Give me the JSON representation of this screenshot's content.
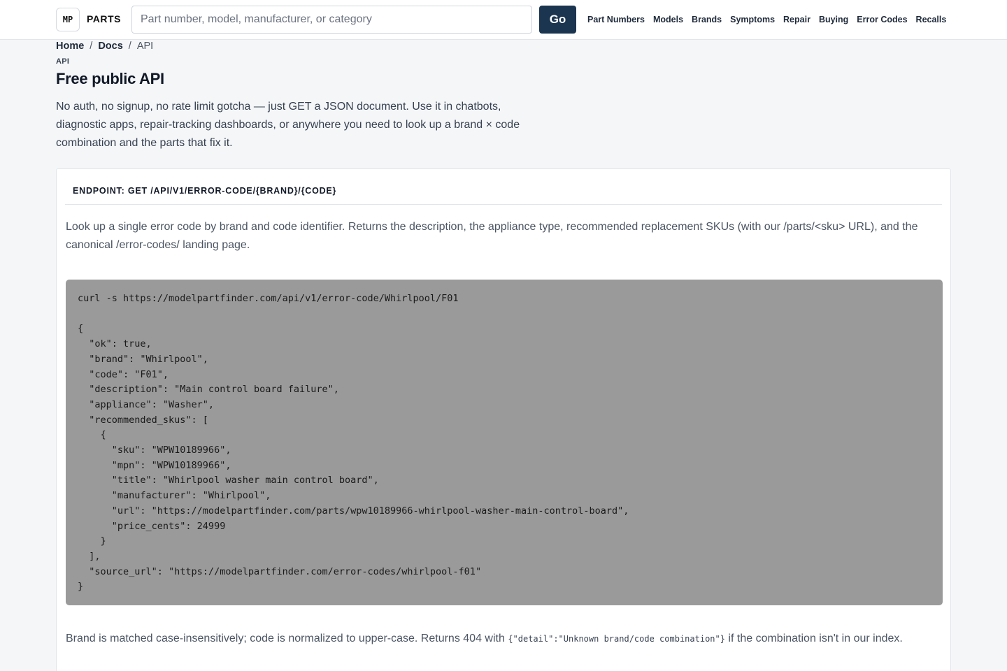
{
  "header": {
    "logo_mark": "MP",
    "logo_text": "PARTS",
    "search_placeholder": "Part number, model, manufacturer, or category",
    "go_label": "Go",
    "nav": [
      {
        "label": "Part Numbers"
      },
      {
        "label": "Models"
      },
      {
        "label": "Brands"
      },
      {
        "label": "Symptoms"
      },
      {
        "label": "Repair"
      },
      {
        "label": "Buying"
      },
      {
        "label": "Error Codes"
      },
      {
        "label": "Recalls"
      }
    ]
  },
  "breadcrumb": {
    "items": [
      "Home",
      "Docs"
    ],
    "separator": "/",
    "current": "API"
  },
  "page": {
    "eyebrow": "API",
    "title": "Free public API",
    "lede": "No auth, no signup, no rate limit gotcha — just GET a JSON document. Use it in chatbots, diagnostic apps, repair-tracking dashboards, or anywhere you need to look up a brand × code combination and the parts that fix it."
  },
  "endpoint": {
    "heading": "ENDPOINT: GET /API/V1/ERROR-CODE/{BRAND}/{CODE}",
    "description": "Look up a single error code by brand and code identifier. Returns the description, the appliance type, recommended replacement SKUs (with our /parts/<sku> URL), and the canonical /error-codes/ landing page.",
    "code": "curl -s https://modelpartfinder.com/api/v1/error-code/Whirlpool/F01\n\n{\n  \"ok\": true,\n  \"brand\": \"Whirlpool\",\n  \"code\": \"F01\",\n  \"description\": \"Main control board failure\",\n  \"appliance\": \"Washer\",\n  \"recommended_skus\": [\n    {\n      \"sku\": \"WPW10189966\",\n      \"mpn\": \"WPW10189966\",\n      \"title\": \"Whirlpool washer main control board\",\n      \"manufacturer\": \"Whirlpool\",\n      \"url\": \"https://modelpartfinder.com/parts/wpw10189966-whirlpool-washer-main-control-board\",\n      \"price_cents\": 24999\n    }\n  ],\n  \"source_url\": \"https://modelpartfinder.com/error-codes/whirlpool-f01\"\n}",
    "note_before": "Brand is matched case-insensitively; code is normalized to upper-case. Returns 404 with ",
    "note_code": "{\"detail\":\"Unknown brand/code combination\"}",
    "note_after": " if the combination isn't in our index."
  }
}
